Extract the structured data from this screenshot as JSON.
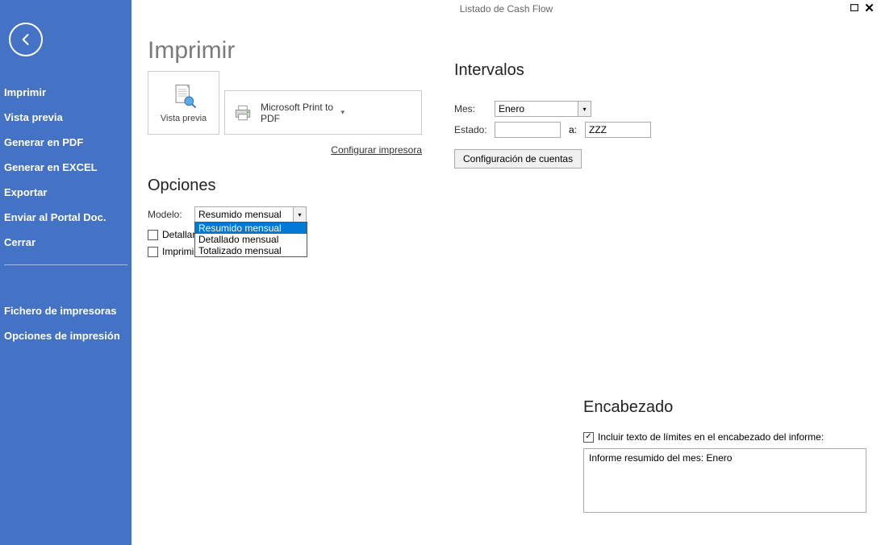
{
  "title_bar": {
    "title": "Listado de Cash Flow"
  },
  "sidebar": {
    "items": [
      "Imprimir",
      "Vista previa",
      "Generar en PDF",
      "Generar en EXCEL",
      "Exportar",
      "Enviar al Portal Doc.",
      "Cerrar"
    ],
    "secondary": [
      "Fichero de impresoras",
      "Opciones de impresión"
    ]
  },
  "main": {
    "heading": "Imprimir",
    "preview_label": "Vista previa",
    "printer_name": "Microsoft Print to PDF",
    "config_printer": "Configurar impresora"
  },
  "options": {
    "heading": "Opciones",
    "model_label": "Modelo:",
    "model_value": "Resumido mensual",
    "model_options": [
      "Resumido mensual",
      "Detallado mensual",
      "Totalizado mensual"
    ],
    "detail_label": "Detallar",
    "reverse_label": "Imprimir en orden inverso"
  },
  "intervals": {
    "heading": "Intervalos",
    "month_label": "Mes:",
    "month_value": "Enero",
    "state_label": "Estado:",
    "state_from": "",
    "state_to_label": "a:",
    "state_to": "ZZZ",
    "config_accounts": "Configuración de cuentas"
  },
  "header": {
    "heading": "Encabezado",
    "include_label": "Incluir texto de límites en el encabezado del informe:",
    "textarea_value": "Informe resumido del mes: Enero"
  }
}
